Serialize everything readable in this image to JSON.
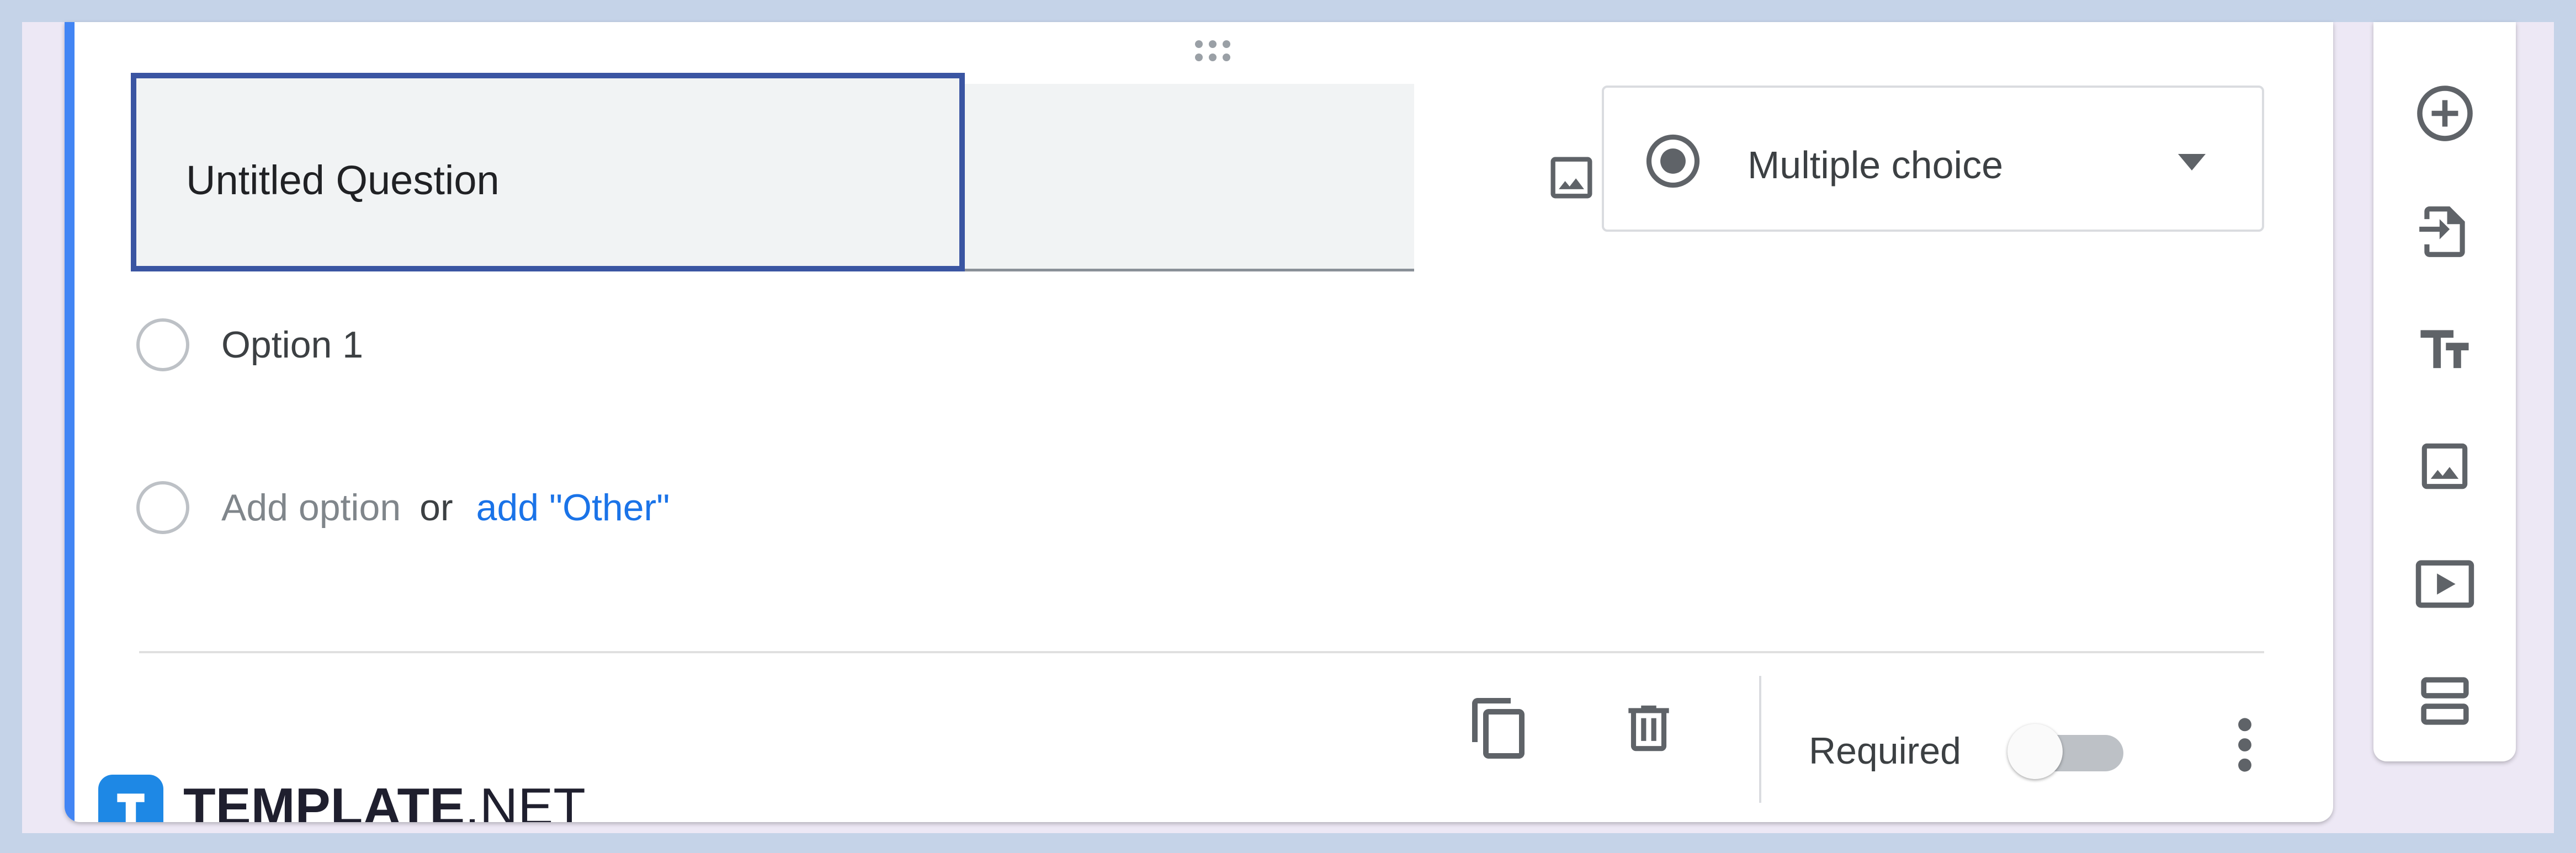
{
  "question": {
    "title": "Untitled Question",
    "type_label": "Multiple choice",
    "options": [
      "Option 1"
    ],
    "add_option_label": "Add option",
    "or_label": "or",
    "add_other_label": "add \"Other\""
  },
  "footer": {
    "required_label": "Required",
    "required_enabled": false
  },
  "brand": {
    "name_bold": "TEMPLATE",
    "name_suffix": ".NET"
  },
  "sidebar": {
    "tools": [
      "add-question-icon",
      "import-questions-icon",
      "title-text-icon",
      "add-image-icon",
      "add-video-icon",
      "add-section-icon"
    ]
  },
  "colors": {
    "accent": "#4285f4",
    "focus_border": "#3a55a2",
    "link": "#1a73e8",
    "background": "#c5d3e8"
  }
}
